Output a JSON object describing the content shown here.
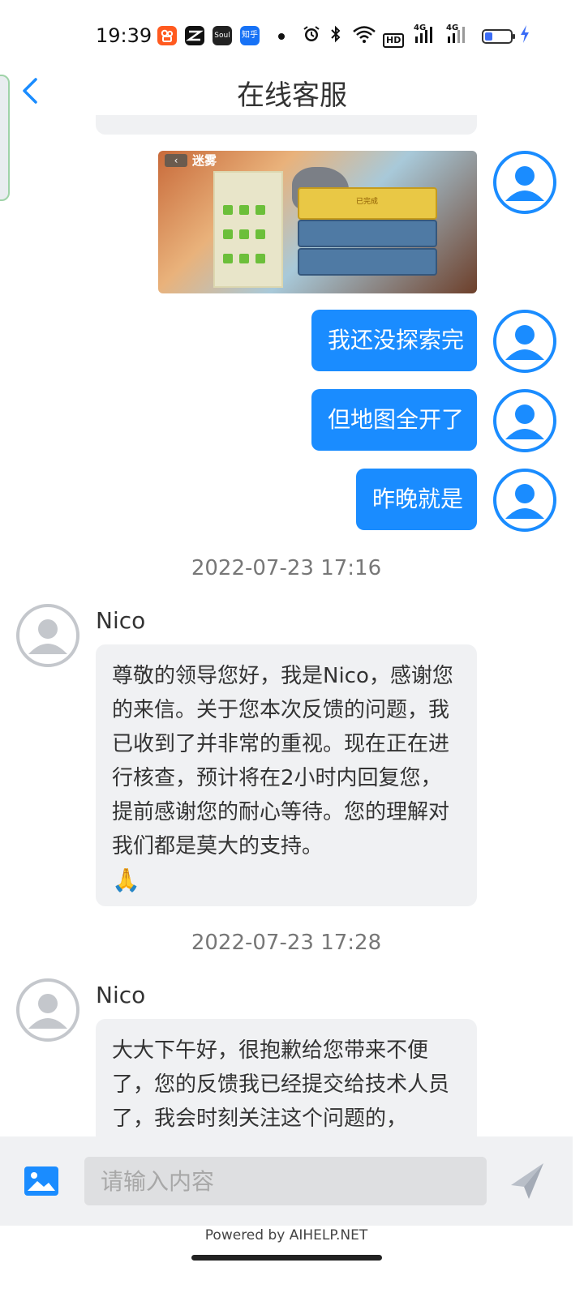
{
  "status_bar": {
    "time": "19:39",
    "apps": [
      {
        "icon": "kuaishou-icon",
        "color": "#ff5a1f",
        "label": ""
      },
      {
        "icon": "capcut-icon",
        "color": "#111111",
        "label": ""
      },
      {
        "icon": "soul-icon",
        "color": "#222222",
        "label": "Soul"
      },
      {
        "icon": "zhihu-icon",
        "color": "#1772f6",
        "label": "知乎"
      }
    ],
    "indicators": [
      "alarm-icon",
      "bluetooth-icon",
      "wifi-icon",
      "hd-icon",
      "signal-4g-icon",
      "signal-4g-icon",
      "battery-icon",
      "charging-icon"
    ],
    "hd_label": "HD",
    "net1": "4G",
    "net2": "4G",
    "battery_level": 0.2
  },
  "header": {
    "title": "在线客服",
    "back_icon": "chevron-left-icon"
  },
  "colors": {
    "accent": "#1a8cff",
    "bubble_agent": "#f0f1f3",
    "input_bar": "#f0f1f3"
  },
  "messages": {
    "image_message": {
      "icon": "screenshot-image",
      "screen_title": "迷雾",
      "banner_text": "已完成"
    },
    "user_1": "我还没探索完",
    "user_2": "但地图全开了",
    "user_3": "昨晚就是",
    "timestamp_1": "2022-07-23 17:16",
    "agent_1_name": "Nico",
    "agent_1_text": "尊敬的领导您好，我是Nico，感谢您的来信。关于您本次反馈的问题，我已收到了并非常的重视。现在正在进行核查，预计将在2小时内回复您，提前感谢您的耐心等待。您的理解对我们都是莫大的支持。",
    "agent_1_emoji": "🙏",
    "timestamp_2": "2022-07-23 17:28",
    "agent_2_name": "Nico",
    "agent_2_text": "大大下午好，很抱歉给您带来不便了，您的反馈我已经提交给技术人员了，我会时刻关注这个问题的，"
  },
  "input_bar": {
    "image_button_icon": "image-icon",
    "placeholder": "请输入内容",
    "value": "",
    "send_icon": "send-icon"
  },
  "footer": {
    "powered_by": "Powered by AIHELP.NET"
  }
}
